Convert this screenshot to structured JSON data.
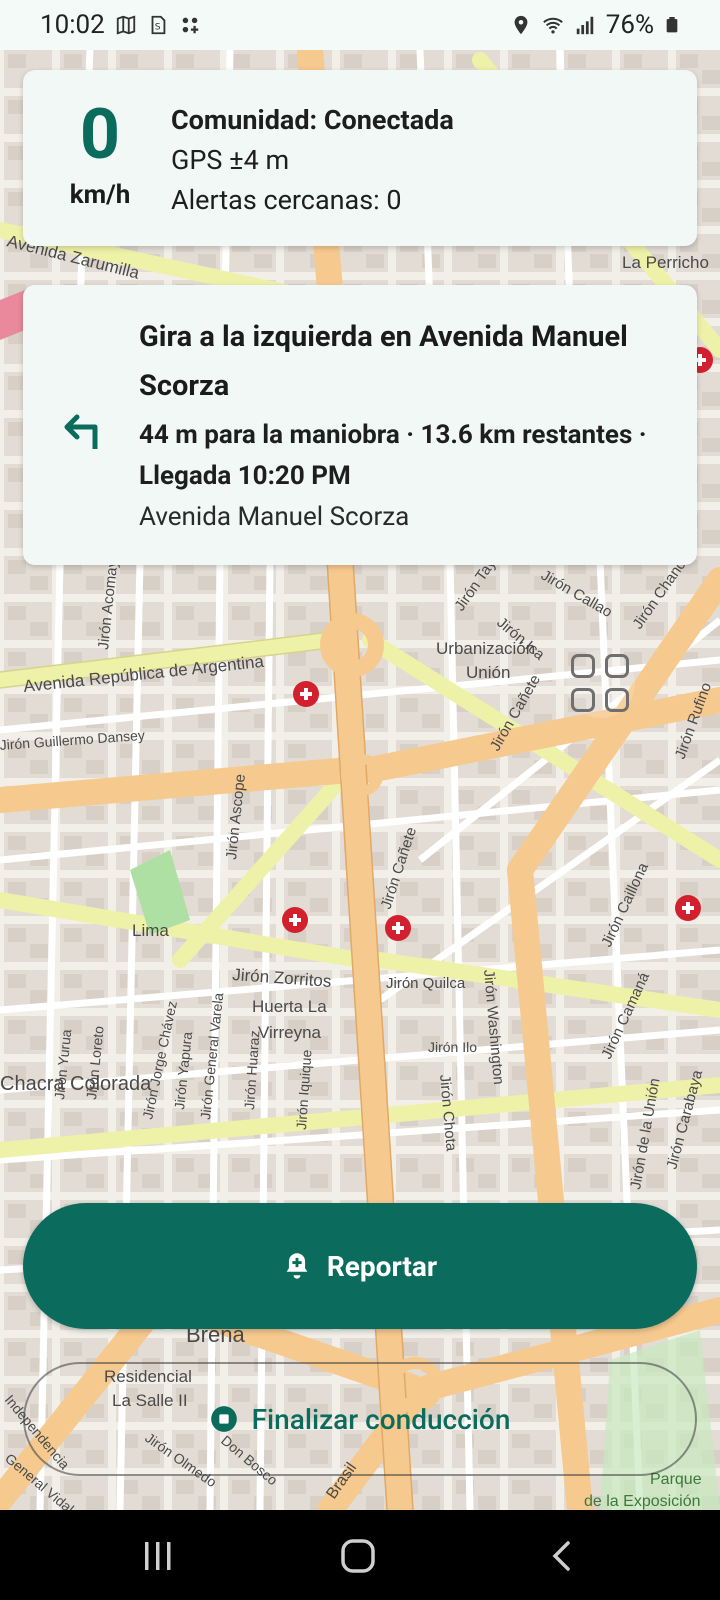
{
  "status_bar": {
    "time": "10:02",
    "battery": "76%",
    "icons_left": [
      "map-icon",
      "sim-icon",
      "app-icon"
    ],
    "icons_right": [
      "location-icon",
      "wifi-icon",
      "signal-icon",
      "battery-icon"
    ]
  },
  "speed_card": {
    "speed": "0",
    "unit": "km/h",
    "community": "Comunidad: Conectada",
    "gps": "GPS ±4 m",
    "alerts": "Alertas cercanas: 0"
  },
  "nav_card": {
    "icon": "turn-left-icon",
    "instruction": "Gira a la izquierda en Avenida Manuel Scorza",
    "detail": "44 m para la maniobra · 13.6 km restantes · Llegada 10:20 PM",
    "street": "Avenida Manuel Scorza"
  },
  "map": {
    "labels": {
      "zarumilla": "Avenida Zarumilla",
      "republica": "Avenida República de Argentina",
      "urbanizacion_union_1": "Urbanización",
      "urbanizacion_union_2": "Unión",
      "zorritos": "Jirón Zorritos",
      "huerta_1": "Huerta La",
      "huerta_2": "Virreyna",
      "quilca": "Jirón Quilca",
      "washington": "Jirón Washington",
      "ilo": "Jirón Ilo",
      "chota": "Jirón Chota",
      "canete": "Jirón Cañete",
      "canete2": "Jirón Cañete",
      "ica": "Jirón Ica",
      "tayacaja": "Jirón Tayacaja",
      "callao": "Jirón Callao",
      "chancay": "Jirón Chancay",
      "caillona": "Jirón Caillona",
      "camana": "Jirón Camaná",
      "union": "Jirón de la Unión",
      "carabaya": "Jirón Carabaya",
      "rufino": "Jirón Rufino",
      "ascope": "Jirón Ascope",
      "acomayo": "Jirón Acomayo",
      "lima": "Lima",
      "chacra": "Chacra Colorada",
      "yurua": "Jirón Yurua",
      "loreto": "Jirón Loreto",
      "jorge_chavez": "Jirón Jorge Chávez",
      "yapura": "Jirón Yapura",
      "varela": "Jirón General Varela",
      "huaraz": "Jirón Huaraz",
      "iquique": "Jirón Iquique",
      "dansey": "Jirón Guillermo Dansey",
      "perrichon": "La Perricho",
      "brena": "Breña",
      "residencial_1": "Residencial",
      "residencial_2": "La Salle II",
      "parque_1": "Parque",
      "parque_2": "de la Exposición",
      "olmedo": "Jirón Olmedo",
      "don_bosco": "Don Bosco",
      "brasil": "Brasil",
      "independencia": "Independencia",
      "general_vidal": "General Vidal"
    }
  },
  "buttons": {
    "report": "Reportar",
    "report_icon": "bell-plus-icon",
    "end": "Finalizar conducción",
    "end_icon": "stop-icon",
    "grid_icon": "grid-icon"
  },
  "colors": {
    "accent": "#0b6b5d",
    "card_bg": "#f1f8f6",
    "map_bg": "#eee8e1",
    "main_road": "#f6c98f",
    "secondary_road": "#eef1a8",
    "hospital": "#d2202e"
  }
}
